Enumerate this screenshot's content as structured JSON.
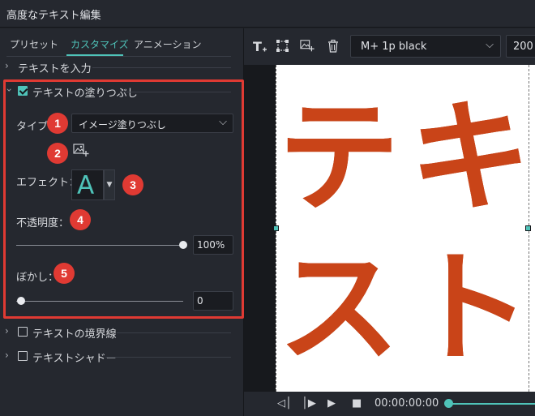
{
  "window": {
    "title": "高度なテキスト編集"
  },
  "tabs": [
    {
      "label": "プリセット"
    },
    {
      "label": "カスタマイズ"
    },
    {
      "label": "アニメーション"
    }
  ],
  "sections": {
    "text_input": {
      "label": "テキストを入力",
      "expanded": false
    },
    "text_fill": {
      "label": "テキストの塗りつぶし",
      "checked": true,
      "expanded": true
    },
    "text_border": {
      "label": "テキストの境界線",
      "checked": false,
      "expanded": false
    },
    "text_shadow": {
      "label": "テキストシャドー",
      "checked": false,
      "expanded": false
    }
  },
  "fill": {
    "type_label": "タイプ：",
    "type_value": "イメージ塗りつぶし",
    "effect_label": "エフェクト：",
    "effect_glyph": "A",
    "opacity_label": "不透明度：",
    "opacity_value": "100%",
    "opacity_fraction": 1.0,
    "blur_label": "ぼかし：",
    "blur_value": "0",
    "blur_fraction": 0.0
  },
  "badges": [
    "1",
    "2",
    "3",
    "4",
    "5"
  ],
  "toolbar": {
    "font_name": "M+ 1p black",
    "font_size": "200",
    "icons": [
      "add-text-icon",
      "transform-box-icon",
      "add-image-icon",
      "trash-icon"
    ]
  },
  "preview": {
    "characters": [
      "テ",
      "キ",
      "ス",
      "ト"
    ]
  },
  "playback": {
    "timecode": "00:00:00:00",
    "icons": [
      "step-back-icon",
      "play-pause-icon",
      "play-icon",
      "stop-icon"
    ]
  },
  "colors": {
    "accent": "#4fc3b9",
    "highlight": "#e03a33",
    "fill_texture": "#c94418",
    "panel_bg": "#25282f"
  }
}
